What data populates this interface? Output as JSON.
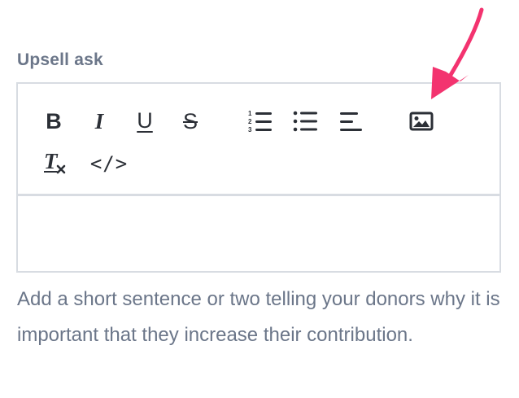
{
  "field": {
    "label": "Upsell ask",
    "help_text": "Add a short sentence or two telling your donors why it is important that they increase their contribution."
  },
  "toolbar": {
    "bold": "B",
    "italic": "I",
    "underline": "U",
    "strike": "S",
    "clear_format": "T",
    "code": "</>"
  },
  "colors": {
    "label": "#6b7689",
    "border": "#d8dce2",
    "icon": "#2b2f36",
    "arrow": "#f3336f"
  }
}
